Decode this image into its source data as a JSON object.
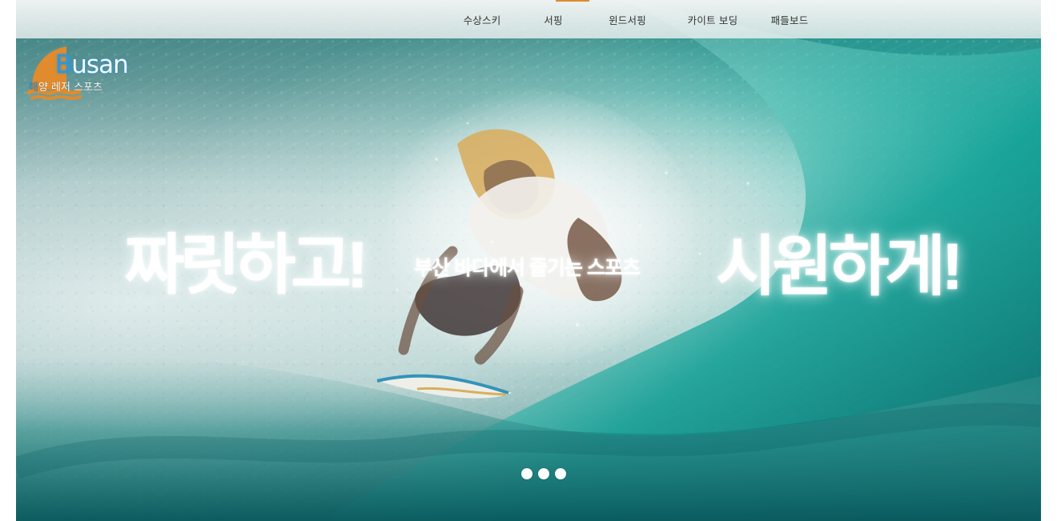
{
  "site": {
    "logo": {
      "word_initial": "B",
      "word_rest": "usan",
      "subtitle_parts": [
        "해",
        "양 레저",
        " 스포츠"
      ],
      "accent": "#e08b2d",
      "blue": "#2e98d8"
    }
  },
  "nav": {
    "items": [
      {
        "label": "수상스키"
      },
      {
        "label": "서핑"
      },
      {
        "label": "윈드서핑"
      },
      {
        "label": "카이트 보딩"
      },
      {
        "label": "패들보드"
      }
    ],
    "active_index": 1
  },
  "hero": {
    "headline_left": "짜릿하고!",
    "headline_middle": "부산 바다에서 즐기는 스포츠",
    "headline_right": "시원하게!",
    "slider_dots": [
      {
        "label": ""
      },
      {
        "label": ""
      },
      {
        "label": ""
      }
    ],
    "colors": {
      "wave_primary": "#15a197",
      "wave_dark": "#0f6668",
      "foam": "#ffffff"
    }
  }
}
